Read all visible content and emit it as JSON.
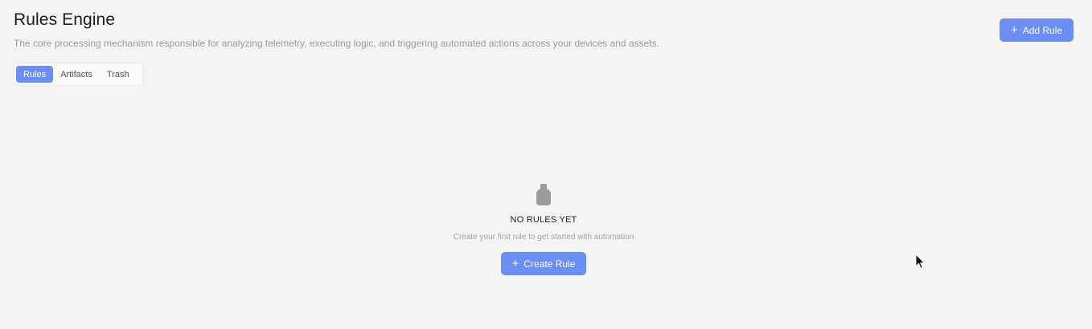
{
  "header": {
    "title": "Rules Engine",
    "subtitle": "The core processing mechanism responsible for analyzing telemetry, executing logic, and triggering automated actions across your devices and assets.",
    "add_button_label": "Add Rule",
    "add_button_icon": "plus-icon"
  },
  "tabs": [
    {
      "label": "Rules",
      "active": true
    },
    {
      "label": "Artifacts",
      "active": false
    },
    {
      "label": "Trash",
      "active": false
    }
  ],
  "empty_state": {
    "icon": "flask-icon",
    "title": "NO RULES YET",
    "description": "Create your first rule to get started with automation",
    "button_label": "Create Rule",
    "button_icon": "plus-icon"
  },
  "colors": {
    "accent": "#6b8ef4",
    "background": "#f4f4f4",
    "icon_gray": "#9c9c9c"
  }
}
